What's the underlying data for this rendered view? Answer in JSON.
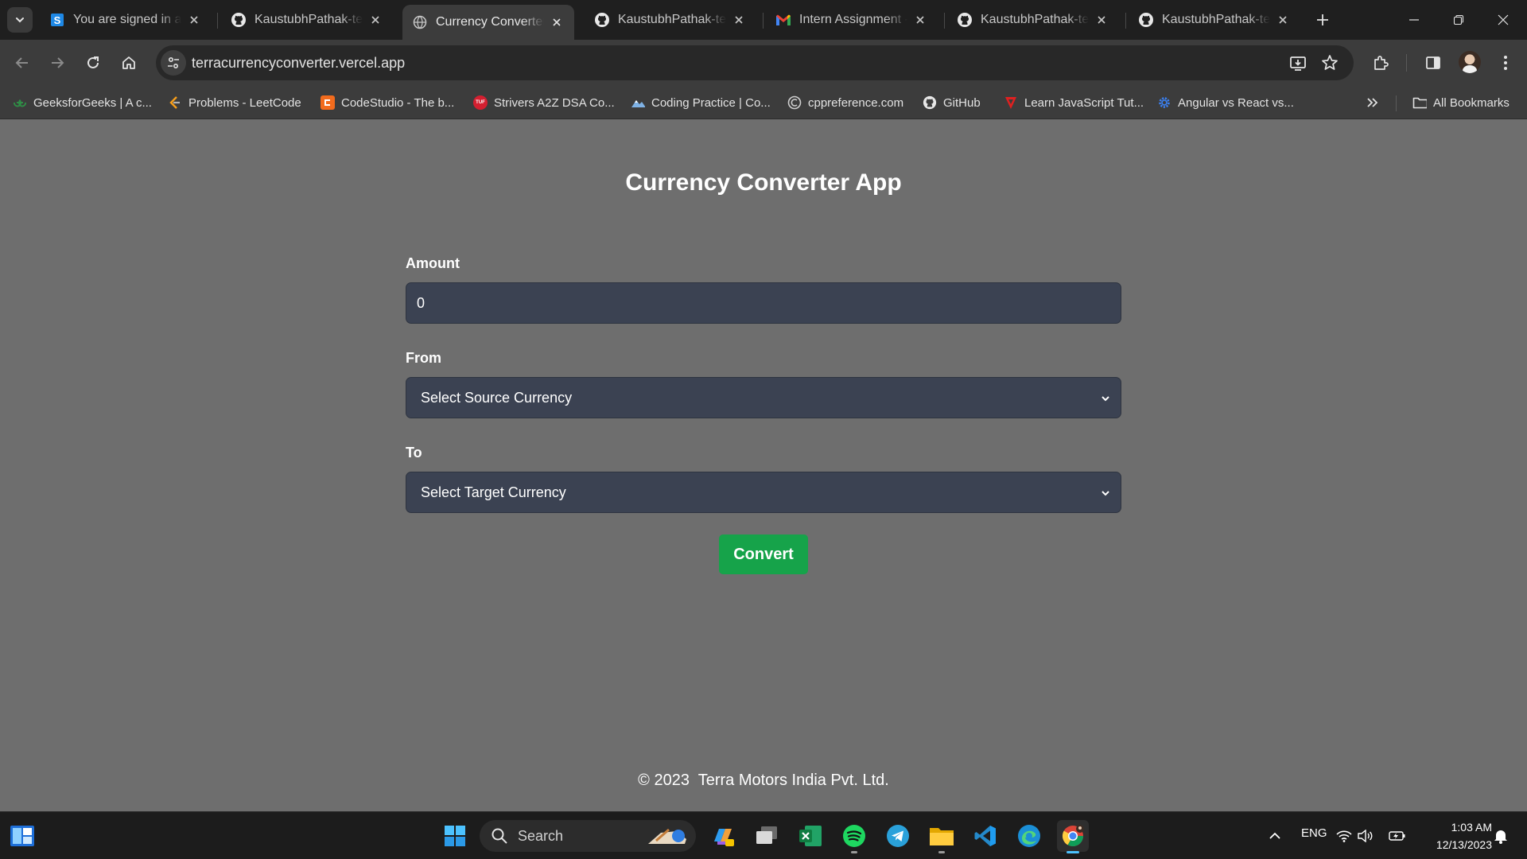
{
  "browser": {
    "tabs": [
      {
        "title": "You are signed in as",
        "favicon": "s-blue-icon",
        "active": false
      },
      {
        "title": "KaustubhPathak-tech",
        "favicon": "github-icon",
        "active": false
      },
      {
        "title": "Currency Converter -",
        "favicon": "globe-icon",
        "active": true
      },
      {
        "title": "KaustubhPathak-tech",
        "favicon": "github-icon",
        "active": false
      },
      {
        "title": "Intern Assignment - I",
        "favicon": "gmail-icon",
        "active": false
      },
      {
        "title": "KaustubhPathak-tech",
        "favicon": "github-icon",
        "active": false
      },
      {
        "title": "KaustubhPathak-tech",
        "favicon": "github-icon",
        "active": false
      }
    ],
    "url": "terracurrencyconverter.vercel.app",
    "bookmarks": [
      {
        "label": "GeeksforGeeks | A c...",
        "icon": "gfg-icon",
        "color": "#2f8d46"
      },
      {
        "label": "Problems - LeetCode",
        "icon": "leetcode-icon",
        "color": "#f89f1b"
      },
      {
        "label": "CodeStudio - The b...",
        "icon": "codestudio-icon",
        "color": "#f26b1d"
      },
      {
        "label": "Strivers A2Z DSA Co...",
        "icon": "tuf-icon",
        "color": "#d41f30"
      },
      {
        "label": "Coding Practice | Co...",
        "icon": "mountain-icon",
        "color": "#7fb2e5"
      },
      {
        "label": "cppreference.com",
        "icon": "cppref-icon",
        "color": "#cfcfcf"
      },
      {
        "label": "GitHub",
        "icon": "github-icon",
        "color": "#ffffff"
      },
      {
        "label": "Learn JavaScript Tut...",
        "icon": "js-tut-icon",
        "color": "#e02020"
      },
      {
        "label": "Angular vs React vs...",
        "icon": "gear-icon",
        "color": "#3b82f6"
      }
    ],
    "all_bookmarks_label": "All Bookmarks"
  },
  "app": {
    "title": "Currency Converter App",
    "amount_label": "Amount",
    "amount_value": "0",
    "from_label": "From",
    "from_selected": "Select Source Currency",
    "to_label": "To",
    "to_selected": "Select Target Currency",
    "convert_label": "Convert",
    "footer": "© 2023  Terra Motors India Pvt. Ltd."
  },
  "taskbar": {
    "search_label": "Search",
    "lang": "ENG",
    "time": "1:03 AM",
    "date": "12/13/2023"
  },
  "colors": {
    "page_bg": "#6e6e6e",
    "field_bg": "#3b4252",
    "button_green": "#16a34a"
  }
}
